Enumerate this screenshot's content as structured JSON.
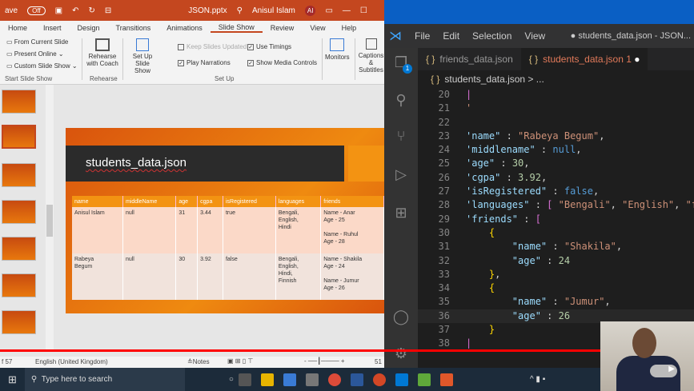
{
  "ppt": {
    "titlebar": {
      "autosave": "ave",
      "toggle": "Off",
      "file": "JSON.pptx",
      "user": "Anisul Islam",
      "initials": "AI"
    },
    "tabs": [
      "Home",
      "Insert",
      "Design",
      "Transitions",
      "Animations",
      "Slide Show",
      "Review",
      "View",
      "Help"
    ],
    "active_tab": "Slide Show",
    "ribbon": {
      "start": {
        "items": [
          "From Current Slide",
          "Present Online",
          "Custom Slide Show"
        ],
        "label": "Start Slide Show"
      },
      "rehearse": {
        "button": "Rehearse with Coach",
        "label": "Rehearse"
      },
      "setup": {
        "button": "Set Up Slide Show",
        "keep_updated": "Keep Slides Updated",
        "play_narrations": "Play Narrations",
        "use_timings": "Use Timings",
        "show_media": "Show Media Controls",
        "label": "Set Up"
      },
      "monitors": "Monitors",
      "captions": "Captions & Subtitles"
    },
    "slide": {
      "title": "students_data.json",
      "headers": [
        "name",
        "middleName",
        "age",
        "cgpa",
        "isRegistered",
        "languages",
        "friends"
      ],
      "rows": [
        [
          "Anisul Islam",
          "null",
          "31",
          "3.44",
          "true",
          "Bengali,\nEnglish,\nHindi",
          "Name - Anar\nAge - 25\n\nName - Ruhul\nAge - 28"
        ],
        [
          "Rabeya\nBegum",
          "null",
          "30",
          "3.92",
          "false",
          "Bengali,\nEnglish,\nHindi,\nFinnish",
          "Name - Shakila\nAge - 24\n\nName - Jumur\nAge - 26"
        ]
      ]
    },
    "status": {
      "slide": "f 57",
      "language": "English (United Kingdom)",
      "notes": "Notes",
      "zoom": "51"
    }
  },
  "vscode": {
    "menu": [
      "File",
      "Edit",
      "Selection",
      "View"
    ],
    "title": "● students_data.json - JSON...",
    "tabs": [
      {
        "label": "friends_data.json"
      },
      {
        "label": "students_data.json 1",
        "dirty": true
      }
    ],
    "breadcrumb": "students_data.json > ...",
    "explorer_badge": "1",
    "code": [
      {
        "n": "20",
        "t": [
          [
            "br",
            "|"
          ]
        ]
      },
      {
        "n": "21",
        "t": [
          [
            "str",
            "'"
          ]
        ]
      },
      {
        "n": "22",
        "t": []
      },
      {
        "n": "23",
        "t": [
          [
            "key",
            "'name\""
          ],
          [
            "p",
            " : "
          ],
          [
            "str",
            "\"Rabeya Begum\""
          ],
          [
            "p",
            ","
          ]
        ]
      },
      {
        "n": "24",
        "t": [
          [
            "key",
            "'middlename\""
          ],
          [
            "p",
            " : "
          ],
          [
            "kw",
            "null"
          ],
          [
            "p",
            ","
          ]
        ]
      },
      {
        "n": "25",
        "t": [
          [
            "key",
            "'age\""
          ],
          [
            "p",
            " : "
          ],
          [
            "num",
            "30"
          ],
          [
            "p",
            ","
          ]
        ]
      },
      {
        "n": "26",
        "t": [
          [
            "key",
            "'cgpa\""
          ],
          [
            "p",
            " : "
          ],
          [
            "num",
            "3.92"
          ],
          [
            "p",
            ","
          ]
        ]
      },
      {
        "n": "27",
        "t": [
          [
            "key",
            "'isRegistered\""
          ],
          [
            "p",
            " : "
          ],
          [
            "kw",
            "false"
          ],
          [
            "p",
            ","
          ]
        ]
      },
      {
        "n": "28",
        "t": [
          [
            "key",
            "'languages\""
          ],
          [
            "p",
            " : "
          ],
          [
            "br",
            "["
          ],
          [
            "p",
            " "
          ],
          [
            "str",
            "\"Bengali\""
          ],
          [
            "p",
            ", "
          ],
          [
            "str",
            "\"English\""
          ],
          [
            "p",
            ", "
          ],
          [
            "str",
            "\"fi"
          ]
        ]
      },
      {
        "n": "29",
        "t": [
          [
            "key",
            "'friends\""
          ],
          [
            "p",
            " : "
          ],
          [
            "br",
            "["
          ]
        ]
      },
      {
        "n": "30",
        "t": [
          [
            "p",
            "    "
          ],
          [
            "cb2",
            "{"
          ]
        ]
      },
      {
        "n": "31",
        "t": [
          [
            "p",
            "        "
          ],
          [
            "key",
            "\"name\""
          ],
          [
            "p",
            " : "
          ],
          [
            "str",
            "\"Shakila\""
          ],
          [
            "p",
            ","
          ]
        ]
      },
      {
        "n": "32",
        "t": [
          [
            "p",
            "        "
          ],
          [
            "key",
            "\"age\""
          ],
          [
            "p",
            " : "
          ],
          [
            "num",
            "24"
          ]
        ]
      },
      {
        "n": "33",
        "t": [
          [
            "p",
            "    "
          ],
          [
            "cb2",
            "}"
          ],
          [
            "p",
            ","
          ]
        ]
      },
      {
        "n": "34",
        "t": [
          [
            "p",
            "    "
          ],
          [
            "cb2",
            "{"
          ]
        ]
      },
      {
        "n": "35",
        "t": [
          [
            "p",
            "        "
          ],
          [
            "key",
            "\"name\""
          ],
          [
            "p",
            " : "
          ],
          [
            "str",
            "\"Jumur\""
          ],
          [
            "p",
            ","
          ]
        ]
      },
      {
        "n": "36",
        "t": [
          [
            "p",
            "        "
          ],
          [
            "key",
            "\"age\""
          ],
          [
            "p",
            " : "
          ],
          [
            "num",
            "26"
          ]
        ]
      },
      {
        "n": "37",
        "t": [
          [
            "p",
            "    "
          ],
          [
            "cb2",
            "}"
          ]
        ]
      },
      {
        "n": "38",
        "t": [
          [
            "br",
            "|"
          ]
        ]
      },
      {
        "n": "39",
        "t": []
      }
    ]
  },
  "taskbar": {
    "search_placeholder": "Type here to search"
  }
}
